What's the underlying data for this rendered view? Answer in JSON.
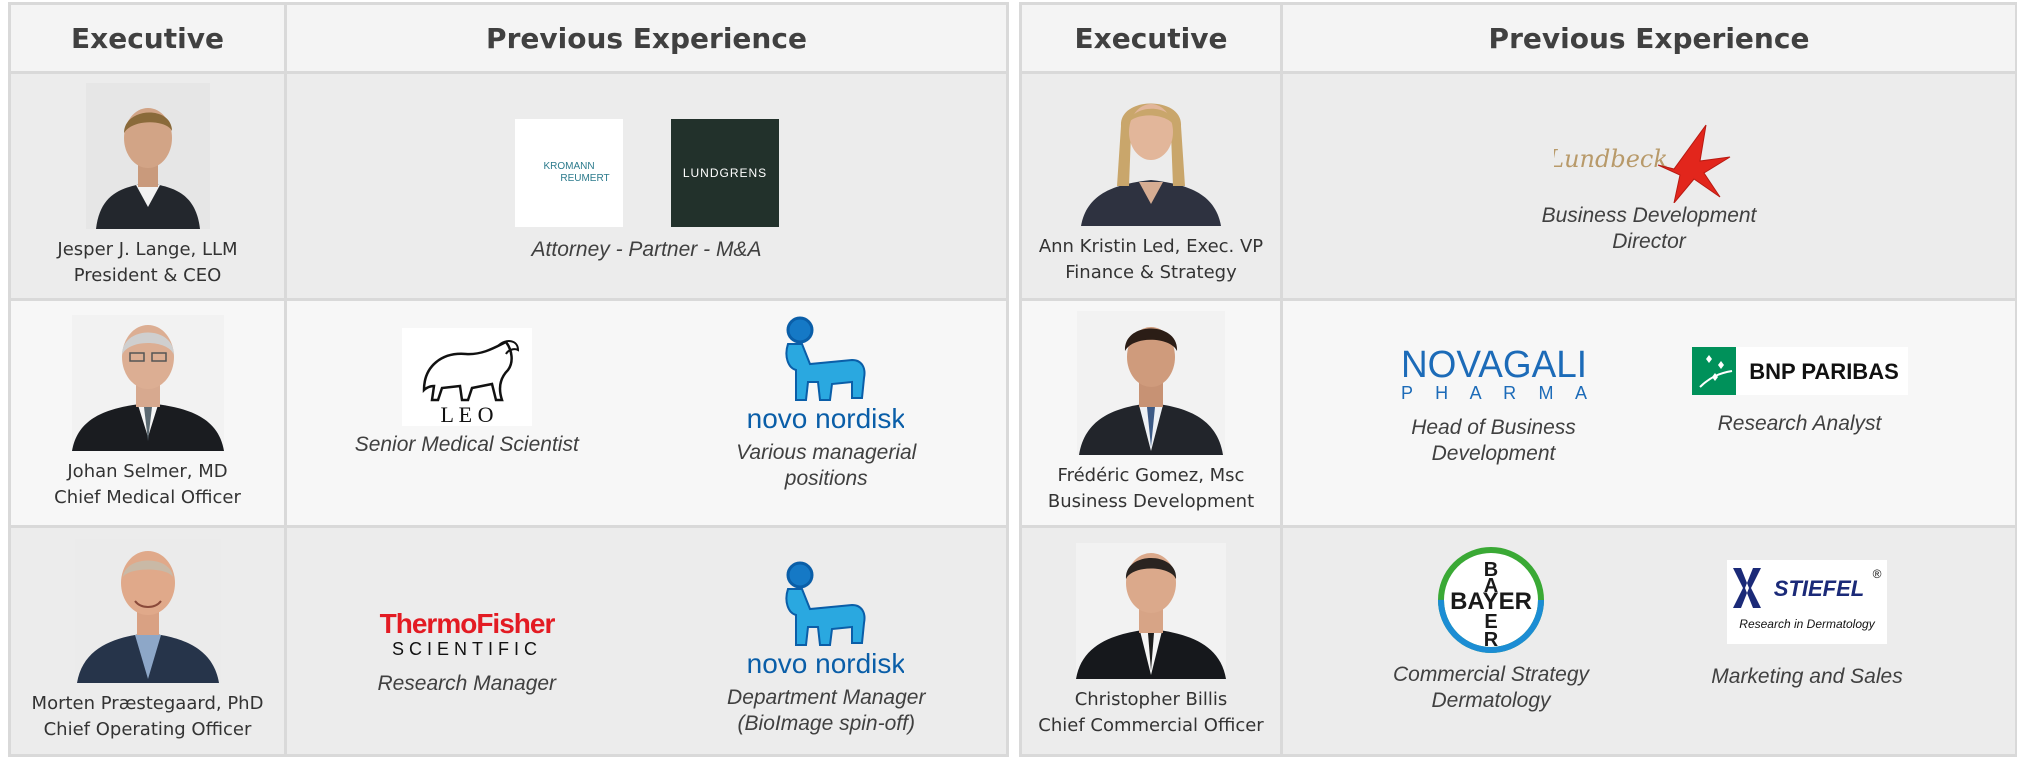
{
  "headers": {
    "executive": "Executive",
    "experience": "Previous Experience"
  },
  "left": [
    {
      "name": "Jesper J. Lange, LLM",
      "title": "President & CEO",
      "logos": [
        {
          "icon": "kromann-reumert-logo",
          "line1": "KROMANN",
          "line2": "REUMERT"
        },
        {
          "icon": "lundgrens-logo",
          "text": "LUNDGRENS"
        }
      ],
      "role": "Attorney - Partner - M&A"
    },
    {
      "name": "Johan Selmer, MD",
      "title": "Chief Medical Officer",
      "companies": [
        {
          "icon": "leo-logo",
          "logo_text": "L E O",
          "role": "Senior Medical Scientist"
        },
        {
          "icon": "novo-nordisk-logo",
          "logo_text": "novo nordisk",
          "role_lines": [
            "Various managerial",
            "positions"
          ]
        }
      ]
    },
    {
      "name": "Morten Præstegaard, PhD",
      "title": "Chief Operating Officer",
      "companies": [
        {
          "icon": "thermo-fisher-logo",
          "logo_line1": "ThermoFisher",
          "logo_line2": "SCIENTIFIC",
          "role": "Research Manager"
        },
        {
          "icon": "novo-nordisk-logo",
          "logo_text": "novo nordisk",
          "role_lines": [
            "Department Manager",
            "(BioImage spin-off)"
          ]
        }
      ]
    }
  ],
  "right": [
    {
      "name": "Ann Kristin Led, Exec. VP",
      "title": "Finance & Strategy",
      "logos": [
        {
          "icon": "lundbeck-logo",
          "text": "Lundbeck"
        }
      ],
      "role_lines": [
        "Business Development",
        "Director"
      ]
    },
    {
      "name": "Frédéric Gomez, Msc",
      "title": "Business Development",
      "companies": [
        {
          "icon": "novagali-logo",
          "logo_line1": "NOVAGALI",
          "logo_line2": "P H A R M A",
          "role_lines": [
            "Head of Business",
            "Development"
          ]
        },
        {
          "icon": "bnp-paribas-logo",
          "logo_text": "BNP PARIBAS",
          "role": "Research Analyst"
        }
      ]
    },
    {
      "name": "Christopher Billis",
      "title": "Chief Commercial Officer",
      "companies": [
        {
          "icon": "bayer-logo",
          "logo_text": "BAYER",
          "role_lines": [
            "Commercial Strategy",
            "Dermatology"
          ]
        },
        {
          "icon": "stiefel-logo",
          "logo_line1": "STIEFEL",
          "logo_line2": "Research in Dermatology",
          "role": "Marketing and Sales"
        }
      ]
    }
  ],
  "colors": {
    "border": "#d9d9d9",
    "header_text": "#404040",
    "novo_blue": "#0a5ea8",
    "thermo_red": "#e31b23",
    "bnp_green": "#00915a",
    "stiefel_navy": "#1b2a78"
  }
}
